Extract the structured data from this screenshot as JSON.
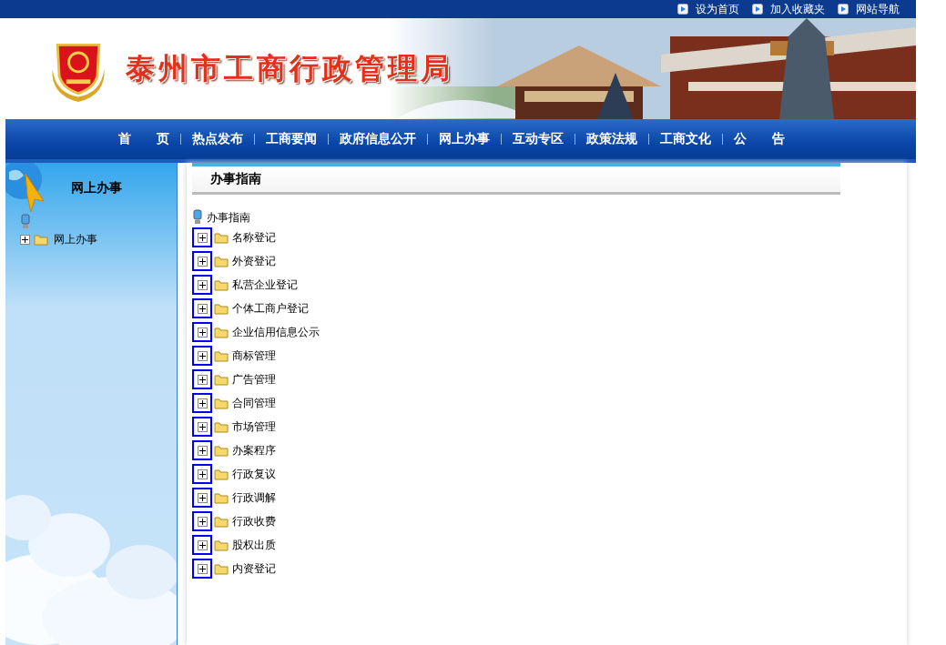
{
  "top_links": [
    "设为首页",
    "加入收藏夹",
    "网站导航"
  ],
  "banner": {
    "title": "泰州市工商行政管理局"
  },
  "nav": [
    {
      "label": "首　　页"
    },
    {
      "label": "热点发布"
    },
    {
      "label": "工商要闻"
    },
    {
      "label": "政府信息公开"
    },
    {
      "label": "网上办事"
    },
    {
      "label": "互动专区"
    },
    {
      "label": "政策法规"
    },
    {
      "label": "工商文化"
    },
    {
      "label": "公　　告"
    }
  ],
  "sidebar": {
    "title": "网上办事",
    "tree": [
      {
        "label": "网上办事",
        "expanded": false
      }
    ]
  },
  "content": {
    "title": "办事指南",
    "tree_root": "办事指南",
    "items": [
      {
        "label": "名称登记",
        "expanded": false
      },
      {
        "label": "外资登记",
        "expanded": false
      },
      {
        "label": "私营企业登记",
        "expanded": false
      },
      {
        "label": "个体工商户登记",
        "expanded": false
      },
      {
        "label": "企业信用信息公示",
        "expanded": false
      },
      {
        "label": "商标管理",
        "expanded": false
      },
      {
        "label": "广告管理",
        "expanded": false
      },
      {
        "label": "合同管理",
        "expanded": false
      },
      {
        "label": "市场管理",
        "expanded": false
      },
      {
        "label": "办案程序",
        "expanded": false
      },
      {
        "label": "行政复议",
        "expanded": false
      },
      {
        "label": "行政调解",
        "expanded": false
      },
      {
        "label": "行政收费",
        "expanded": false
      },
      {
        "label": "股权出质",
        "expanded": false
      },
      {
        "label": "内资登记",
        "expanded": false
      }
    ]
  }
}
